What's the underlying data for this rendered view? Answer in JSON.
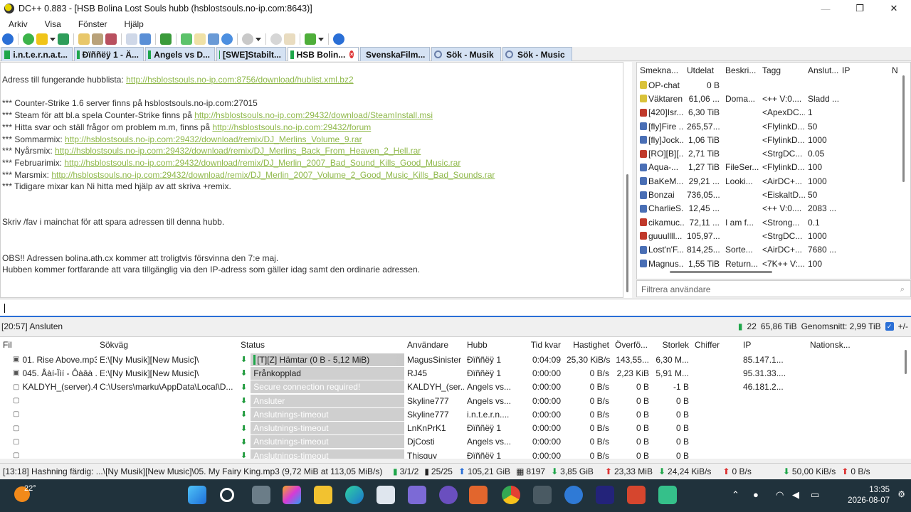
{
  "window": {
    "title": "DC++ 0.883 - [HSB Bolina Lost Souls hubb (hsblostsouls.no-ip.com:8643)]",
    "minimize": "—",
    "maximize": "❐",
    "close": "✕"
  },
  "menu": [
    "Arkiv",
    "Visa",
    "Fönster",
    "Hjälp"
  ],
  "tabs": [
    {
      "label": "i.n.t.e.r.n.a.t...",
      "kind": "hub"
    },
    {
      "label": "Ðïññëÿ 1 - Ä...",
      "kind": "hub"
    },
    {
      "label": "Angels vs D...",
      "kind": "hub"
    },
    {
      "label": "[SWE]Stabilt...",
      "kind": "hub"
    },
    {
      "label": "HSB Bolin...",
      "kind": "hub",
      "active": true,
      "close": "×"
    },
    {
      "label": "SvenskaFilm...",
      "kind": "hub"
    },
    {
      "label": "Sök - Musik",
      "kind": "search"
    },
    {
      "label": "Sök - Music",
      "kind": "search"
    }
  ],
  "chat": {
    "lines": [
      {
        "text": "Adress till fungerande hubblista: ",
        "link": "http://hsblostsouls.no-ip.com:8756/download/hublist.xml.bz2"
      },
      {
        "text": ""
      },
      {
        "text": "*** Counter-Strike 1.6 server finns på hsblostsouls.no-ip.com:27015",
        "link": ""
      },
      {
        "text": "*** Steam för att bl.a spela Counter-Strike finns på ",
        "link": "http://hsblostsouls.no-ip.com:29432/download/SteamInstall.msi"
      },
      {
        "text": "*** Hitta svar och ställ frågor om problem m.m, finns på ",
        "link": "http://hsblostsouls.no-ip.com:29432/forum"
      },
      {
        "text": "*** Sommarmix: ",
        "link": "http://hsblostsouls.no-ip.com:29432/download/remix/DJ_Merlins_Volume_9.rar"
      },
      {
        "text": "*** Nyårsmix: ",
        "link": "http://hsblostsouls.no-ip.com:29432/download/remix/DJ_Merlins_Back_From_Heaven_2_Hell.rar"
      },
      {
        "text": "*** Februarimix: ",
        "link": "http://hsblostsouls.no-ip.com:29432/download/remix/DJ_Merlin_2007_Bad_Sound_Kills_Good_Music.rar"
      },
      {
        "text": "*** Marsmix: ",
        "link": "http://hsblostsouls.no-ip.com:29432/download/remix/DJ_Merlin_2007_Volume_2_Good_Music_Kills_Bad_Sounds.rar"
      },
      {
        "text": "*** Tidigare mixar kan Ni hitta med hjälp av att skriva +remix.",
        "link": ""
      },
      {
        "text": ""
      },
      {
        "text": ""
      },
      {
        "text": "Skriv /fav i mainchat för att spara adressen till denna hubb.",
        "link": ""
      },
      {
        "text": ""
      },
      {
        "text": ""
      },
      {
        "text": "OBS!! Adressen bolina.ath.cx kommer att troligtvis försvinna den 7:e maj.",
        "link": ""
      },
      {
        "text": "Hubben kommer fortfarande att vara tillgänglig via den IP-adress som gäller idag samt den ordinarie adressen.",
        "link": ""
      }
    ]
  },
  "userlist": {
    "columns": [
      "Smekna...",
      "Utdelat",
      "Beskri...",
      "Tagg",
      "Anslut...",
      "IP",
      "N"
    ],
    "rows": [
      {
        "nick": "OP-chat",
        "share": "0 B",
        "desc": "",
        "tag": "",
        "conn": "",
        "icon": "#d9c23a"
      },
      {
        "nick": "Väktaren",
        "share": "61,06 ...",
        "desc": "Doma...",
        "tag": "<++ V:0....",
        "conn": "Sladd ...",
        "icon": "#d9c23a"
      },
      {
        "nick": "[420]Isr...",
        "share": "6,30 TiB",
        "desc": "",
        "tag": "<ApexDC...",
        "conn": "1",
        "icon": "#c0392b"
      },
      {
        "nick": "[fly]Fire ...",
        "share": "265,57...",
        "desc": "",
        "tag": "<FlylinkD...",
        "conn": "50",
        "icon": "#4a6fb5"
      },
      {
        "nick": "[fly]Jock...",
        "share": "1,06 TiB",
        "desc": "",
        "tag": "<FlylinkD...",
        "conn": "1000",
        "icon": "#4a6fb5"
      },
      {
        "nick": "[RO][B][...",
        "share": "2,71 TiB",
        "desc": "",
        "tag": "<StrgDC...",
        "conn": "0.05",
        "icon": "#c0392b"
      },
      {
        "nick": "Aqua-...",
        "share": "1,27 TiB",
        "desc": "FileSer...",
        "tag": "<FlylinkD...",
        "conn": "100",
        "icon": "#4a6fb5"
      },
      {
        "nick": "BaKeM...",
        "share": "29,21 ...",
        "desc": "Looki...",
        "tag": "<AirDC+...",
        "conn": "1000",
        "icon": "#4a6fb5"
      },
      {
        "nick": "Bonzai",
        "share": "736,05...",
        "desc": "",
        "tag": "<EiskaltD...",
        "conn": "50",
        "icon": "#4a6fb5"
      },
      {
        "nick": "CharlieS...",
        "share": "12,45 ...",
        "desc": "",
        "tag": "<++ V:0....",
        "conn": "2083 ...",
        "icon": "#4a6fb5"
      },
      {
        "nick": "cikamuc...",
        "share": "72,11 ...",
        "desc": "I am f...",
        "tag": "<Strong...",
        "conn": "0.1",
        "icon": "#c0392b"
      },
      {
        "nick": "guuullll...",
        "share": "105,97...",
        "desc": "",
        "tag": "<StrgDC...",
        "conn": "1000",
        "icon": "#c0392b"
      },
      {
        "nick": "Lost'n'F...",
        "share": "814,25...",
        "desc": "Sorte...",
        "tag": "<AirDC+...",
        "conn": "7680 ...",
        "icon": "#4a6fb5"
      },
      {
        "nick": "Magnus...",
        "share": "1,55 TiB",
        "desc": "Return...",
        "tag": "<7K++ V:...",
        "conn": "100",
        "icon": "#4a6fb5"
      }
    ],
    "filter_placeholder": "Filtrera användare"
  },
  "statusrow": {
    "left": "[20:57] Ansluten",
    "users": "22",
    "share": "65,86 TiB",
    "avg": "Genomsnitt: 2,99 TiB",
    "plusminus": "+/-"
  },
  "transfers": {
    "columns": [
      "Fil",
      "Sökväg",
      "Status",
      "Användare",
      "Hubb",
      "Tid kvar",
      "Hastighet",
      "Överfö...",
      "Storlek",
      "Chiffer",
      "IP",
      "Nationsk..."
    ],
    "rows": [
      {
        "file": "01. Rise Above.mp3",
        "path": "E:\\[Ny Musik][New Music]\\",
        "status": "[T][Z] Hämtar (0 B - 5,12 MiB)",
        "style": "first",
        "user": "MagusSinister",
        "hub": "Ðïññëÿ 1",
        "tid": "0:04:09",
        "speed": "25,30 KiB/s",
        "over": "143,55...",
        "size": "6,30 M...",
        "cipher": "",
        "ip": "85.147.1...",
        "nat": ""
      },
      {
        "file": "045. Åàí-Ïìí - Ôàâà ...",
        "path": "E:\\[Ny Musik][New Music]\\",
        "status": "Frånkopplad",
        "style": "second",
        "user": "RJ45",
        "hub": "Ðïññëÿ 1",
        "tid": "0:00:00",
        "speed": "0 B/s",
        "over": "2,23 KiB",
        "size": "5,91 M...",
        "cipher": "",
        "ip": "95.31.33....",
        "nat": ""
      },
      {
        "file": "KALDYH_(server).4...",
        "path": "C:\\Users\\marku\\AppData\\Local\\D...",
        "status": "Secure connection required!",
        "style": "",
        "user": "KALDYH_(ser...",
        "hub": "Angels vs...",
        "tid": "0:00:00",
        "speed": "0 B/s",
        "over": "0 B",
        "size": "-1 B",
        "cipher": "",
        "ip": "46.181.2...",
        "nat": ""
      },
      {
        "file": "",
        "path": "",
        "status": "Ansluter",
        "style": "",
        "user": "Skyline777",
        "hub": "Angels vs...",
        "tid": "0:00:00",
        "speed": "0 B/s",
        "over": "0 B",
        "size": "0 B",
        "cipher": "",
        "ip": "",
        "nat": ""
      },
      {
        "file": "",
        "path": "",
        "status": "Anslutnings-timeout",
        "style": "",
        "user": "Skyline777",
        "hub": "i.n.t.e.r.n....",
        "tid": "0:00:00",
        "speed": "0 B/s",
        "over": "0 B",
        "size": "0 B",
        "cipher": "",
        "ip": "",
        "nat": ""
      },
      {
        "file": "",
        "path": "",
        "status": "Anslutnings-timeout",
        "style": "",
        "user": "LnKnPrK1",
        "hub": "Ðïññëÿ 1",
        "tid": "0:00:00",
        "speed": "0 B/s",
        "over": "0 B",
        "size": "0 B",
        "cipher": "",
        "ip": "",
        "nat": ""
      },
      {
        "file": "",
        "path": "",
        "status": "Anslutnings-timeout",
        "style": "",
        "user": "DjCosti",
        "hub": "Angels vs...",
        "tid": "0:00:00",
        "speed": "0 B/s",
        "over": "0 B",
        "size": "0 B",
        "cipher": "",
        "ip": "",
        "nat": ""
      },
      {
        "file": "",
        "path": "",
        "status": "Anslutnings-timeout",
        "style": "",
        "user": "Thisguy",
        "hub": "Ðïññëÿ 1",
        "tid": "0:00:00",
        "speed": "0 B/s",
        "over": "0 B",
        "size": "0 B",
        "cipher": "",
        "ip": "",
        "nat": ""
      }
    ]
  },
  "bottom": {
    "hash": "[13:18] Hashning färdig: ...\\[Ny Musik][New Music]\\05. My Fairy King.mp3 (9,72 MiB at 113,05 MiB/s)",
    "slots": "3/1/2",
    "dl_slots": "25/25",
    "up_total": "105,21 GiB",
    "queue": "8197",
    "down_total": "3,85 GiB",
    "up_rate_total": "23,33 MiB",
    "down_rate": "24,24 KiB/s",
    "up_rate": "0 B/s",
    "dl_limit": "50,00 KiB/s",
    "ul_limit": "0 B/s"
  },
  "taskbar": {
    "temp": "22°",
    "time": "13:35",
    "date": "2026-08-07"
  }
}
